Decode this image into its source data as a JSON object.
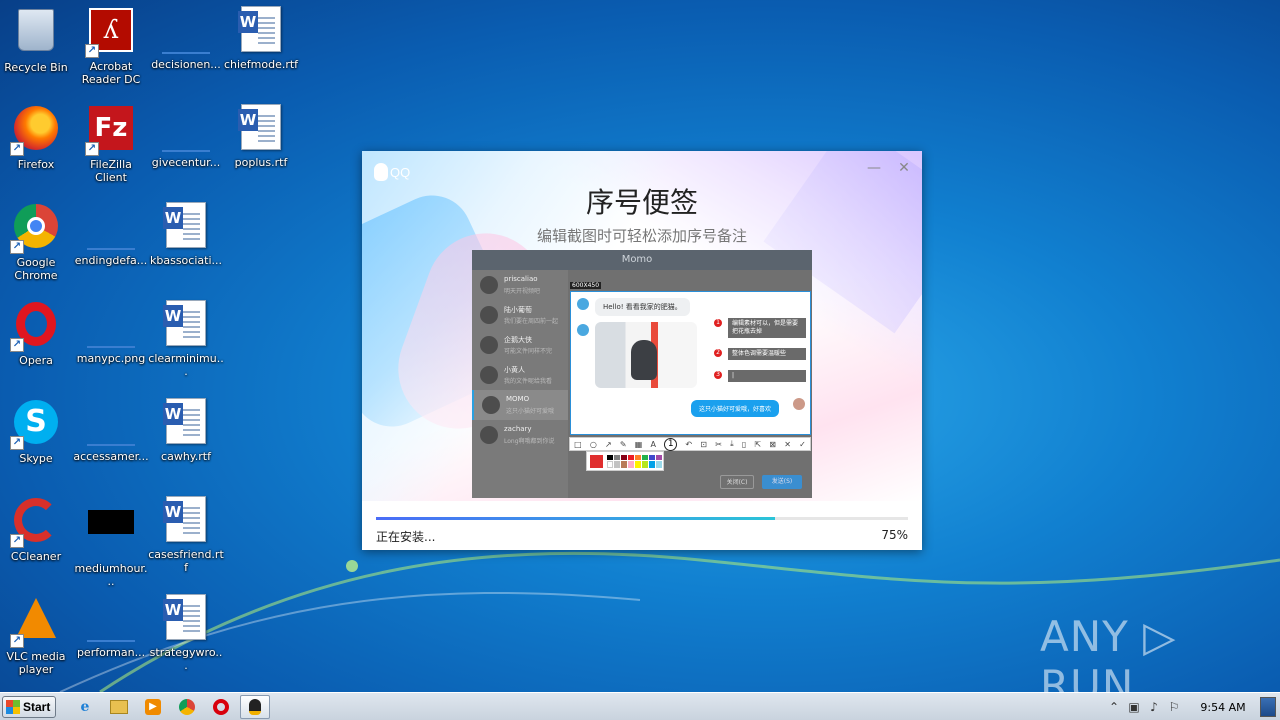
{
  "desktop": {
    "icons": [
      {
        "label": "Recycle Bin",
        "icon": "recycle-bin-icon"
      },
      {
        "label": "Acrobat Reader DC",
        "icon": "acrobat-icon"
      },
      {
        "label": "decisionen...",
        "icon": "blank-file-icon"
      },
      {
        "label": "chiefmode.rtf",
        "icon": "word-doc-icon"
      },
      {
        "label": "Firefox",
        "icon": "firefox-icon"
      },
      {
        "label": "FileZilla Client",
        "icon": "filezilla-icon"
      },
      {
        "label": "givecentur...",
        "icon": "blank-file-icon"
      },
      {
        "label": "poplus.rtf",
        "icon": "word-doc-icon"
      },
      {
        "label": "Google Chrome",
        "icon": "chrome-icon"
      },
      {
        "label": "endingdefa...",
        "icon": "blank-file-icon"
      },
      {
        "label": "kbassociati...",
        "icon": "word-doc-icon"
      },
      {
        "label": "Opera",
        "icon": "opera-icon"
      },
      {
        "label": "manypc.png",
        "icon": "blank-file-icon"
      },
      {
        "label": "clearminimu...",
        "icon": "word-doc-icon"
      },
      {
        "label": "Skype",
        "icon": "skype-icon"
      },
      {
        "label": "accessamer...",
        "icon": "blank-file-icon"
      },
      {
        "label": "cawhy.rtf",
        "icon": "word-doc-icon"
      },
      {
        "label": "CCleaner",
        "icon": "ccleaner-icon"
      },
      {
        "label": "mediumhour...",
        "icon": "black-file-icon"
      },
      {
        "label": "casesfriend.rtf",
        "icon": "word-doc-icon"
      },
      {
        "label": "VLC media player",
        "icon": "vlc-icon"
      },
      {
        "label": "performan...",
        "icon": "blank-file-icon"
      },
      {
        "label": "strategywro...",
        "icon": "word-doc-icon"
      }
    ]
  },
  "installer": {
    "logo_text": "QQ",
    "title": "序号便签",
    "subtitle": "编辑截图时可轻松添加序号备注",
    "minimize_glyph": "—",
    "close_glyph": "✕",
    "status": "正在安装...",
    "progress_percent": 75,
    "progress_label": "75%",
    "preview": {
      "window_title": "Momo",
      "size_tag": "600X450",
      "contacts": [
        {
          "name": "priscaliao",
          "msg": "明天开视频吧"
        },
        {
          "name": "陆小葡萄",
          "msg": "我们要在周四前一起"
        },
        {
          "name": "企鹅大侠",
          "msg": "可能文件同样不完"
        },
        {
          "name": "小黄人",
          "msg": "我的文件呢给我看"
        },
        {
          "name": "MOMO",
          "msg": "这只小猫好可爱哦"
        },
        {
          "name": "zachary",
          "msg": "Long啊哦都到你说"
        }
      ],
      "chat_left": "Hello! 看看我家的肥猫。",
      "notes": [
        "编辑素材可以，但是需要把花瓶去掉",
        "整体色调需要温暖些",
        "|"
      ],
      "note_numbers": [
        "1",
        "2",
        "3"
      ],
      "chat_right": "这只小猫好可爱哦，好喜欢",
      "toolbar_number": "1",
      "btn_close": "关闭(C)",
      "btn_send": "发送(S)"
    }
  },
  "watermark": "ANY ▷ RUN",
  "taskbar": {
    "start_label": "Start",
    "apps": [
      "ie-icon",
      "explorer-icon",
      "media-player-icon",
      "chrome-icon",
      "opera-icon",
      "qq-installer-icon"
    ],
    "clock": "9:54 AM"
  }
}
